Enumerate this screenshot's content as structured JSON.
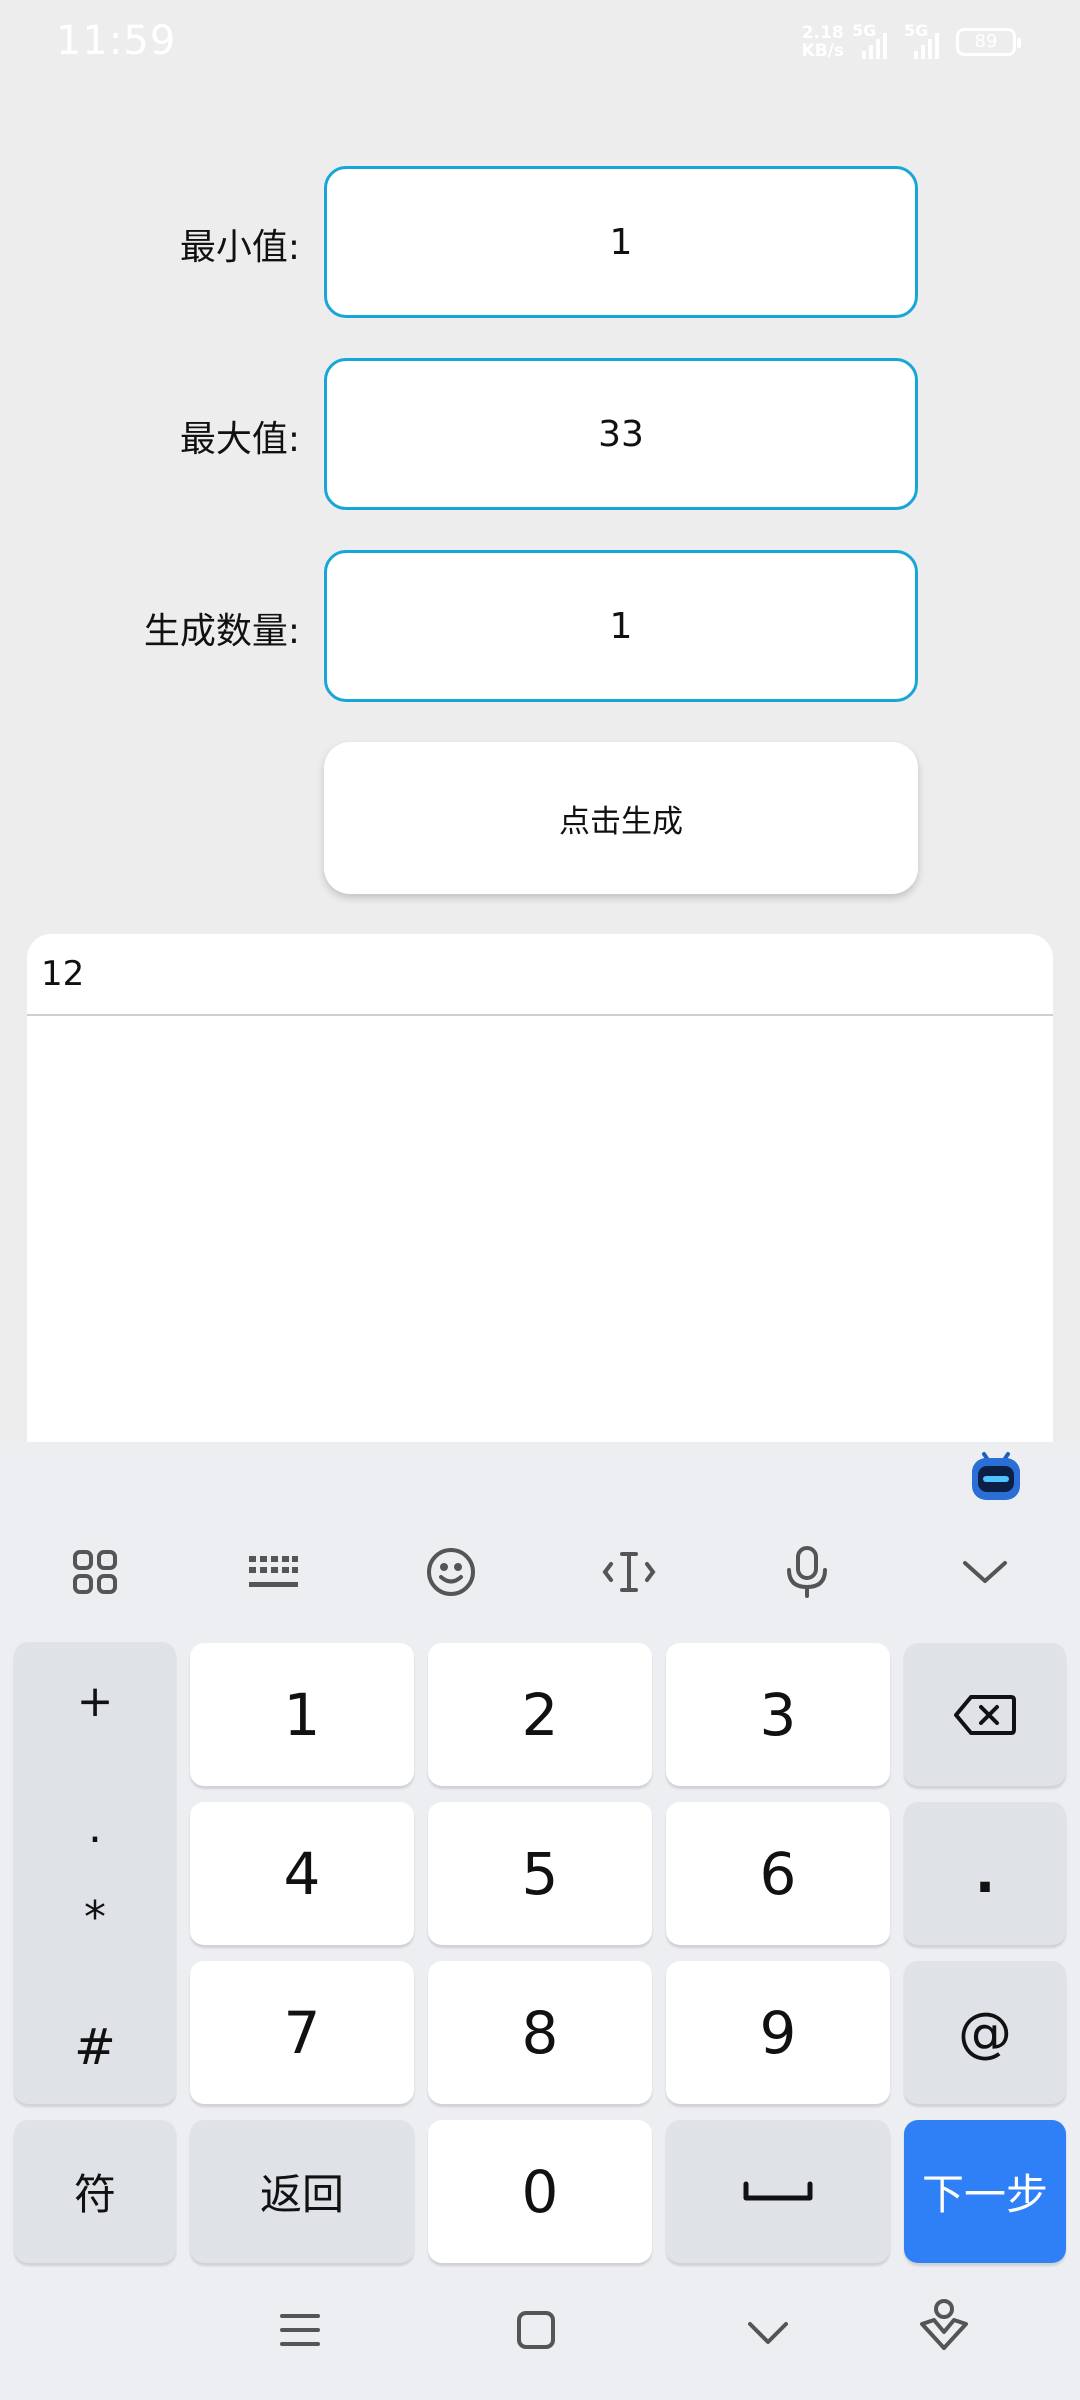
{
  "status_bar": {
    "time": "11:59",
    "net_speed_value": "2.18",
    "net_speed_unit": "KB/s",
    "network_1": "5G",
    "network_2": "5G",
    "battery": "89"
  },
  "form": {
    "min_label": "最小值:",
    "min_value": "1",
    "max_label": "最大值:",
    "max_value": "33",
    "count_label": "生成数量:",
    "count_value": "1",
    "generate_button": "点击生成"
  },
  "result": {
    "value": "12"
  },
  "keyboard": {
    "toolbar_icons": [
      "apps-grid-icon",
      "keyboard-icon",
      "emoji-icon",
      "text-cursor-icon",
      "microphone-icon",
      "collapse-chevron-icon"
    ],
    "symbols": [
      "+",
      ".",
      "*",
      "#"
    ],
    "digits": [
      "1",
      "2",
      "3",
      "4",
      "5",
      "6",
      "7",
      "8",
      "9",
      "0"
    ],
    "right_keys": {
      "dot": ".",
      "at": "@"
    },
    "symbol_key": "符",
    "back_key": "返回",
    "next_key": "下一步",
    "accent_color": "#2f7ff6"
  },
  "colors": {
    "field_border": "#18a6d8",
    "background": "#ededed"
  }
}
